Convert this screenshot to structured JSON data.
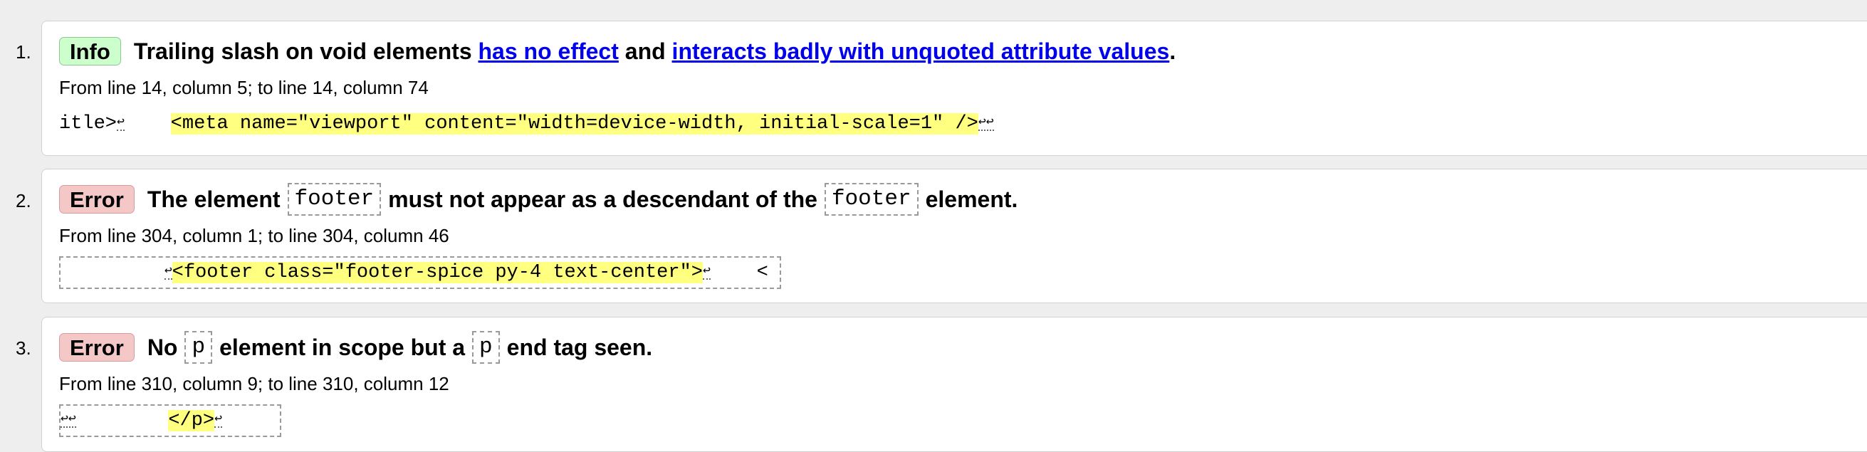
{
  "messages": [
    {
      "number": "1.",
      "type": "Info",
      "text_before": "Trailing slash on void elements",
      "link1": "has no effect",
      "text_middle": "and",
      "link2": "interacts badly with unquoted attribute values",
      "text_after": ".",
      "location": "From line 14, column 5; to line 14, column 74",
      "extract_before": "itle>",
      "extract_nl1": "↩",
      "extract_space": "    ",
      "extract_highlight": "<meta name=\"viewport\" content=\"width=device-width, initial-scale=1\" />",
      "extract_nl2": "↩↩"
    },
    {
      "number": "2.",
      "type": "Error",
      "text_before": "The element",
      "code1": "footer",
      "text_middle": "must not appear as a descendant of the",
      "code2": "footer",
      "text_after": "element.",
      "location": "From line 304, column 1; to line 304, column 46",
      "extract_lead": "         ",
      "extract_nl1": "↩",
      "extract_highlight": "<footer class=\"footer-spice py-4 text-center\">",
      "extract_nl2": "↩",
      "extract_tail": "    <"
    },
    {
      "number": "3.",
      "type": "Error",
      "text_before": "No",
      "code1": "p",
      "text_middle": "element in scope but a",
      "code2": "p",
      "text_after": "end tag seen.",
      "location": "From line 310, column 9; to line 310, column 12",
      "extract_nl1": "↩↩",
      "extract_space": "        ",
      "extract_highlight": "</p>",
      "extract_nl2": "↩",
      "extract_tail": "    "
    }
  ],
  "colors": {
    "info_badge": "#ccffcc",
    "error_badge": "#f5c8c8",
    "highlight": "#ffff80",
    "link": "#0000ee"
  }
}
